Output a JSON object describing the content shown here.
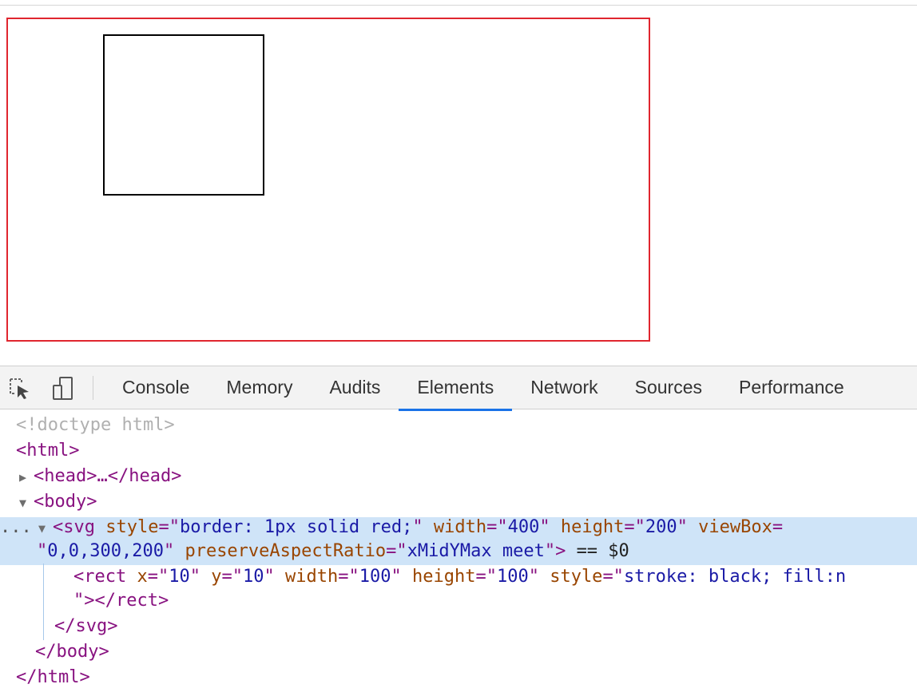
{
  "toolbar": {
    "icons": [
      "inspect-element-icon",
      "device-toolbar-icon"
    ],
    "tabs": [
      {
        "label": "Console"
      },
      {
        "label": "Memory"
      },
      {
        "label": "Audits"
      },
      {
        "label": "Elements",
        "active": true
      },
      {
        "label": "Network"
      },
      {
        "label": "Sources"
      },
      {
        "label": "Performance"
      }
    ]
  },
  "colors": {
    "svg_border": "#e0262f",
    "active_tab_underline": "#1a73e8",
    "selected_row": "#cfe4f8",
    "tag": "#881280",
    "attr_name": "#994500",
    "attr_value": "#1a1aa6"
  },
  "tree": {
    "doctype": "<!doctype html>",
    "html_open": "<html>",
    "head_collapsed": "<head>…</head>",
    "body_open": "<body>",
    "svg_tag_open": "<svg",
    "svg_style_attr": "style",
    "svg_style_val": "border: 1px solid red;",
    "svg_width_attr": "width",
    "svg_width_val": "400",
    "svg_height_attr": "height",
    "svg_height_val": "200",
    "svg_viewbox_attr": "viewBox",
    "svg_viewbox_val": "0,0,300,200",
    "svg_par_attr": "preserveAspectRatio",
    "svg_par_val": "xMidYMax meet",
    "svg_tag_close": ">",
    "selected_marker": "== $0",
    "rect_tag_open": "<rect",
    "rect_x_attr": "x",
    "rect_x_val": "10",
    "rect_y_attr": "y",
    "rect_y_val": "10",
    "rect_width_attr": "width",
    "rect_width_val": "100",
    "rect_height_attr": "height",
    "rect_height_val": "100",
    "rect_style_attr": "style",
    "rect_style_val": "stroke: black; fill:n",
    "rect_close": "\"></rect>",
    "svg_close": "</svg>",
    "body_close": "</body>",
    "html_close": "</html>",
    "ellipsis": "..."
  }
}
